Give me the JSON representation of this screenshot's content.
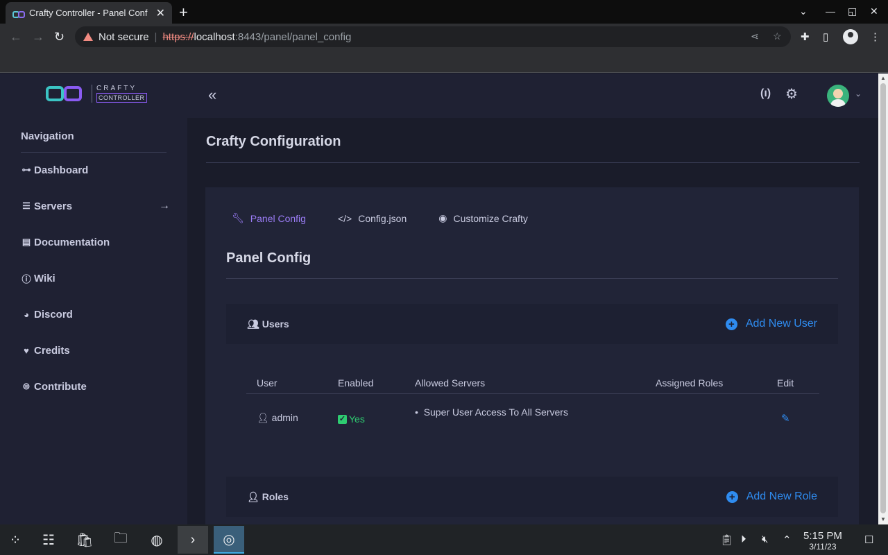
{
  "browser": {
    "tab_title": "Crafty Controller - Panel Conf",
    "tab_close": "✕",
    "new_tab": "+",
    "security_label": "Not secure",
    "url_scheme": "https://",
    "url_host": "localhost",
    "url_rest": ":8443/panel/panel_config"
  },
  "logo": {
    "line1": "CRAFTY",
    "line2": "CONTROLLER"
  },
  "sidebar": {
    "heading": "Navigation",
    "items": [
      {
        "label": "Dashboard",
        "icon": "sitemap-icon"
      },
      {
        "label": "Servers",
        "icon": "server-icon"
      },
      {
        "label": "Documentation",
        "icon": "book-icon"
      },
      {
        "label": "Wiki",
        "icon": "info-circle-icon"
      },
      {
        "label": "Discord",
        "icon": "discord-icon"
      },
      {
        "label": "Credits",
        "icon": "heart-icon"
      },
      {
        "label": "Contribute",
        "icon": "donate-icon"
      }
    ]
  },
  "page": {
    "title": "Crafty Configuration",
    "tabs": [
      {
        "label": "Panel Config",
        "icon": "wrench-icon",
        "active": true
      },
      {
        "label": "Config.json",
        "icon": "code-icon",
        "active": false
      },
      {
        "label": "Customize Crafty",
        "icon": "palette-icon",
        "active": false
      }
    ],
    "section_heading": "Panel Config"
  },
  "users_panel": {
    "title": "Users",
    "add_label": "Add New User",
    "columns": [
      "User",
      "Enabled",
      "Allowed Servers",
      "Assigned Roles",
      "Edit"
    ],
    "rows": [
      {
        "user": "admin",
        "enabled": "Yes",
        "servers": "Super User Access To All Servers",
        "roles": ""
      }
    ]
  },
  "roles_panel": {
    "title": "Roles",
    "add_label": "Add New Role"
  },
  "taskbar": {
    "time": "5:15 PM",
    "date": "3/11/23"
  },
  "colors": {
    "accent_purple": "#9a7cf5",
    "link_blue": "#2f8cf0",
    "success_green": "#2ecc71",
    "bg_dark": "#1a1c2a"
  }
}
